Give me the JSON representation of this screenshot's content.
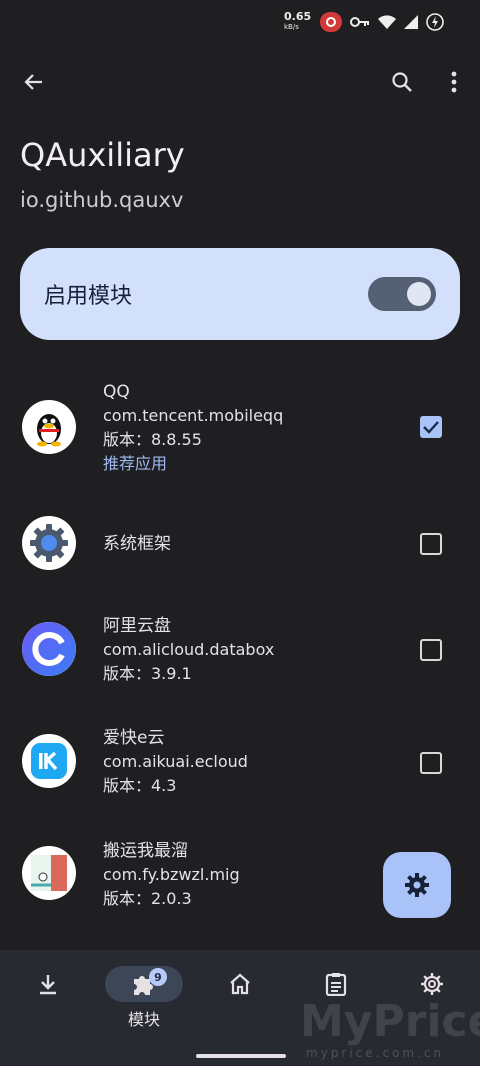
{
  "status_bar": {
    "speed_value": "0.65",
    "speed_unit": "kB/s"
  },
  "app_bar": {
    "back": "arrow-left-icon",
    "search": "search-icon",
    "more": "more-vert-icon"
  },
  "header": {
    "title": "QAuxiliary",
    "package": "io.github.qauxv"
  },
  "enable_card": {
    "label": "启用模块",
    "enabled": true
  },
  "apps": [
    {
      "name": "QQ",
      "package": "com.tencent.mobileqq",
      "version": "版本：8.8.55",
      "tag": "推荐应用",
      "checked": true,
      "icon": "qq-penguin-icon"
    },
    {
      "name": "系统框架",
      "checked": false,
      "icon": "android-system-gear-icon"
    },
    {
      "name": "阿里云盘",
      "package": "com.alicloud.databox",
      "version": "版本：3.9.1",
      "checked": false,
      "icon": "aliyun-drive-icon"
    },
    {
      "name": "爱快e云",
      "package": "com.aikuai.ecloud",
      "version": "版本：4.3",
      "checked": false,
      "icon": "ikuai-icon"
    },
    {
      "name": "搬运我最溜",
      "package": "com.fy.bzwzl.mig",
      "version": "版本：2.0.3",
      "checked": false,
      "icon": "game-icon"
    }
  ],
  "fab": {
    "icon": "settings-gear-icon"
  },
  "bottom_nav": {
    "items": [
      {
        "key": "download",
        "label": "",
        "icon": "download-icon"
      },
      {
        "key": "modules",
        "label": "模块",
        "icon": "puzzle-icon",
        "badge": "9",
        "active": true
      },
      {
        "key": "home",
        "label": "",
        "icon": "home-icon"
      },
      {
        "key": "logs",
        "label": "",
        "icon": "clipboard-icon"
      },
      {
        "key": "settings",
        "label": "",
        "icon": "settings-icon"
      }
    ]
  },
  "watermark": {
    "brand": "MyPrice",
    "site": "myprice.com.cn"
  },
  "colors": {
    "background": "#1f1f22",
    "card": "#d3e0fb",
    "accent": "#a9c3f8",
    "nav_bg": "#272a31"
  }
}
